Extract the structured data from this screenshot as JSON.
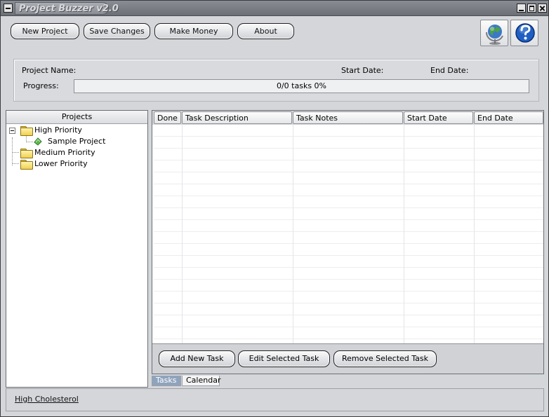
{
  "window": {
    "title": "Project Buzzer v2.0"
  },
  "toolbar": {
    "new_project": "New Project",
    "save_changes": "Save Changes",
    "make_money": "Make Money",
    "about": "About",
    "globe_icon": "globe-icon",
    "help_icon": "help-icon"
  },
  "info": {
    "project_name_label": "Project Name:",
    "start_date_label": "Start Date:",
    "end_date_label": "End Date:",
    "progress_label": "Progress:",
    "progress_text": "0/0 tasks  0%",
    "progress_fraction": 0
  },
  "projects": {
    "header": "Projects",
    "nodes": [
      {
        "label": "High Priority",
        "icon": "folder-icon",
        "expanded": true,
        "children": [
          {
            "label": "Sample Project",
            "icon": "project-leaf-icon"
          }
        ]
      },
      {
        "label": "Medium Priority",
        "icon": "folder-icon"
      },
      {
        "label": "Lower Priority",
        "icon": "folder-icon"
      }
    ]
  },
  "tasks": {
    "columns": [
      "Done",
      "Task Description",
      "Task Notes",
      "Start Date",
      "End Date"
    ],
    "rows": [],
    "add_button": "Add New Task",
    "edit_button": "Edit Selected Task",
    "remove_button": "Remove Selected Task"
  },
  "tabs": {
    "tasks": "Tasks",
    "calendar": "Calendar",
    "active": "Tasks"
  },
  "status": {
    "link": "High Cholesterol"
  }
}
